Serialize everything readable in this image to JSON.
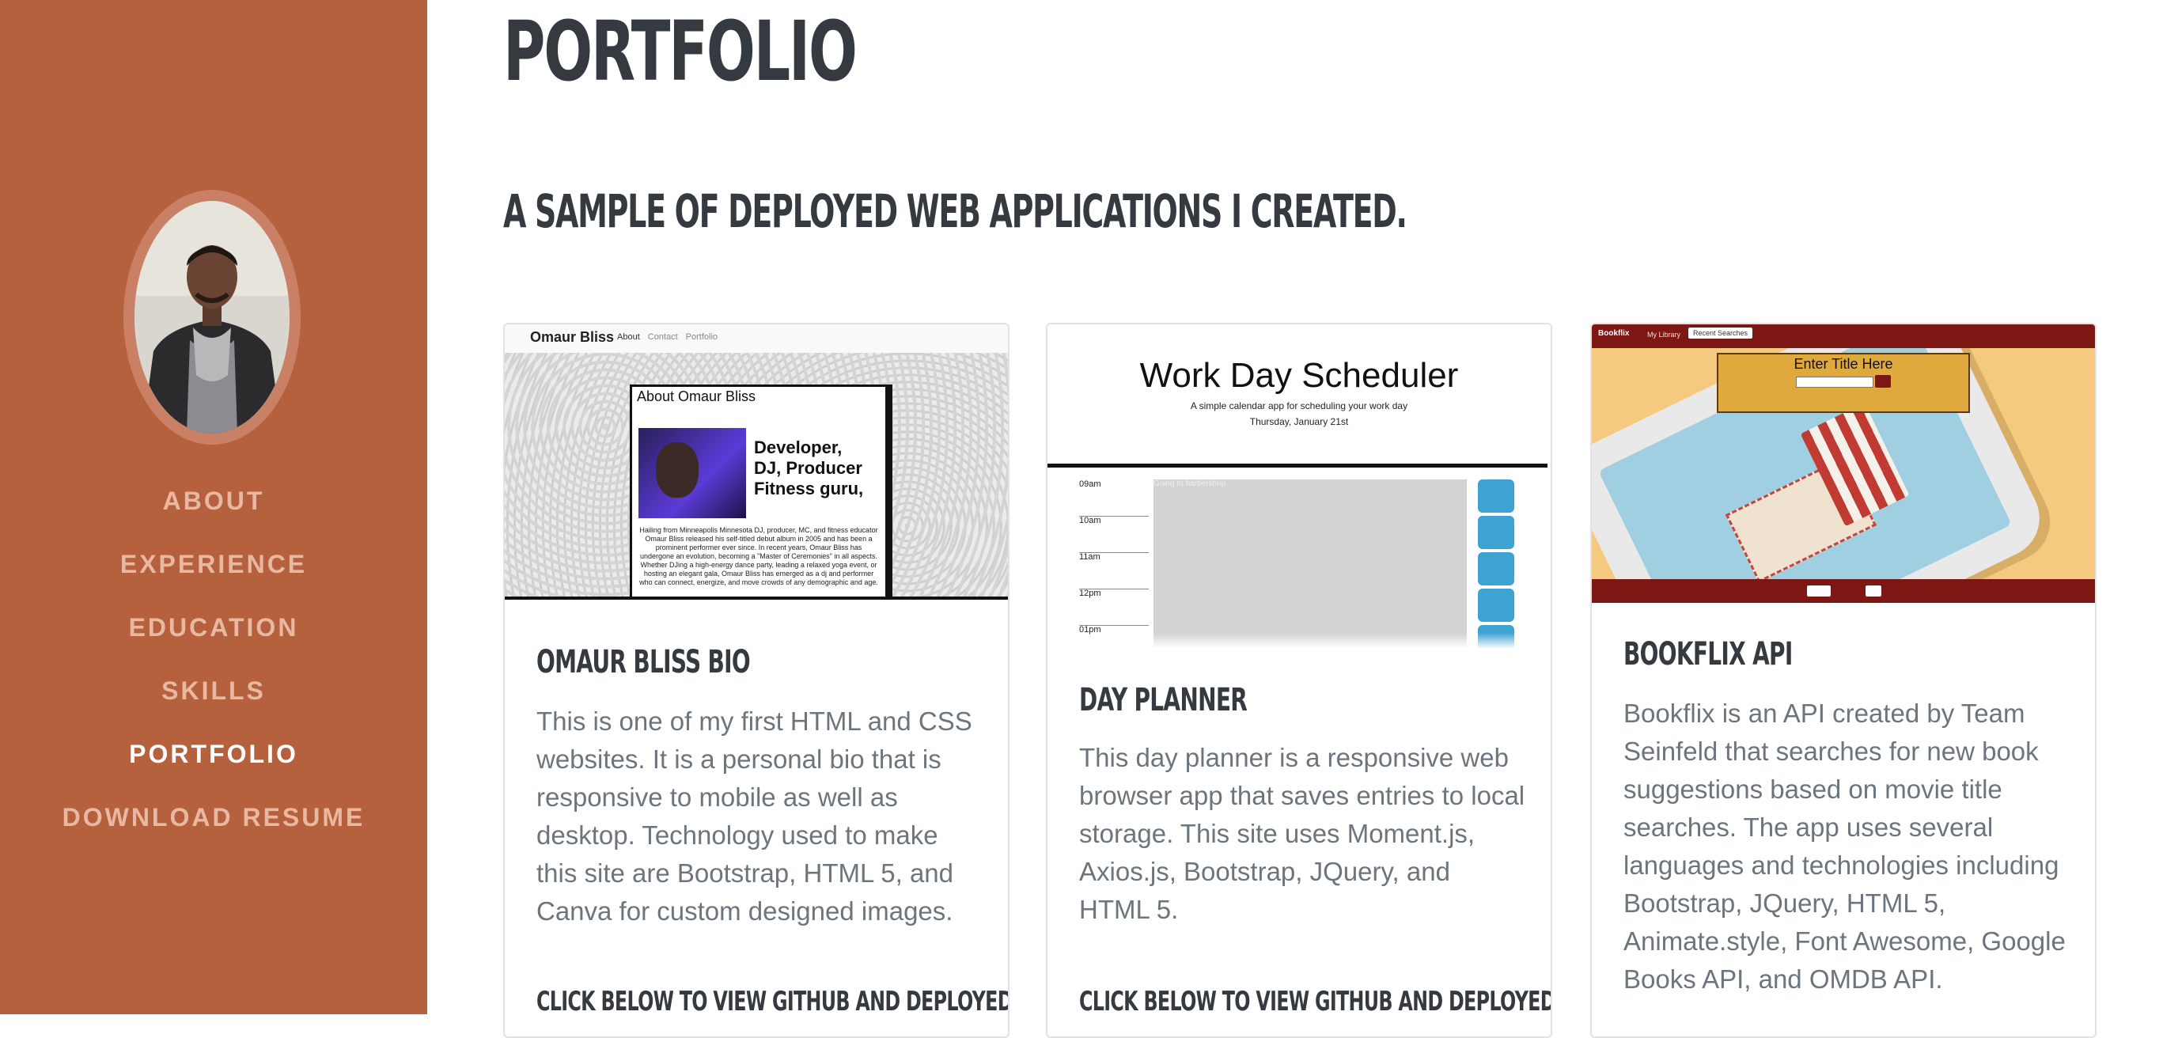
{
  "sidebar": {
    "nav": [
      {
        "label": "ABOUT"
      },
      {
        "label": "EXPERIENCE"
      },
      {
        "label": "EDUCATION"
      },
      {
        "label": "SKILLS"
      },
      {
        "label": "PORTFOLIO"
      },
      {
        "label": "DOWNLOAD RESUME"
      }
    ],
    "active": "PORTFOLIO"
  },
  "main": {
    "title": "PORTFOLIO",
    "subtitle": "A SAMPLE OF DEPLOYED WEB APPLICATIONS I CREATED.",
    "cards": [
      {
        "title": "OMAUR BLISS BIO",
        "text": "This is one of my first HTML and CSS websites. It is a personal bio that is responsive to mobile as well as desktop. Technology used to make this site are Bootstrap, HTML 5, and Canva for custom designed images.",
        "link": "CLICK BELOW TO VIEW GITHUB AND DEPLOYED APP",
        "thumb": {
          "logo": "Omaur Bliss",
          "nav_links": [
            "About",
            "Contact",
            "Portfolio"
          ],
          "panel_title": "About Omaur Bliss",
          "tagline": "Developer, DJ, Producer Fitness guru,",
          "paragraph": "Hailing from Minneapolis Minnesota DJ, producer, MC, and fitness educator Omaur Bliss released his self-titled debut album in 2005 and has been a prominent performer ever since. In recent years, Omaur Bliss has undergone an evolution, becoming a \"Master of Ceremonies\" in all aspects. Whether DJing a high-energy dance party, leading a relaxed yoga event, or hosting an elegant gala, Omaur Bliss has emerged as a dj and performer who can connect, energize, and move crowds of any demographic and age."
        }
      },
      {
        "title": "DAY PLANNER",
        "text": "This day planner is a responsive web browser app that saves entries to local storage. This site uses Moment.js, Axios.js, Bootstrap, JQuery, and HTML 5.",
        "link": "CLICK BELOW TO VIEW GITHUB AND DEPLOYED APP",
        "thumb": {
          "title": "Work Day Scheduler",
          "subtitle": "A simple calendar app for scheduling your work day",
          "date": "Thursday, January 21st",
          "hours": [
            "09am",
            "10am",
            "11am",
            "12pm",
            "01pm"
          ],
          "entry": "Going to barbershop"
        }
      },
      {
        "title": "BOOKFLIX API",
        "text": "Bookflix is an API created by Team Seinfeld that searches for new book suggestions based on movie title searches. The app uses several languages and technologies including Bootstrap, JQuery, HTML 5, Animate.style, Font Awesome, Google Books API, and OMDB API.",
        "thumb": {
          "brand": "Bookflix",
          "library": "My Library",
          "recent": "Recent Searches",
          "form_title": "Enter Title Here"
        }
      }
    ]
  },
  "colors": {
    "sidebar_bg": "#b5613d",
    "nav_text": "#e9b8a3",
    "nav_active": "#ffffff",
    "heading": "#343a40",
    "body_text": "#6c757d"
  }
}
